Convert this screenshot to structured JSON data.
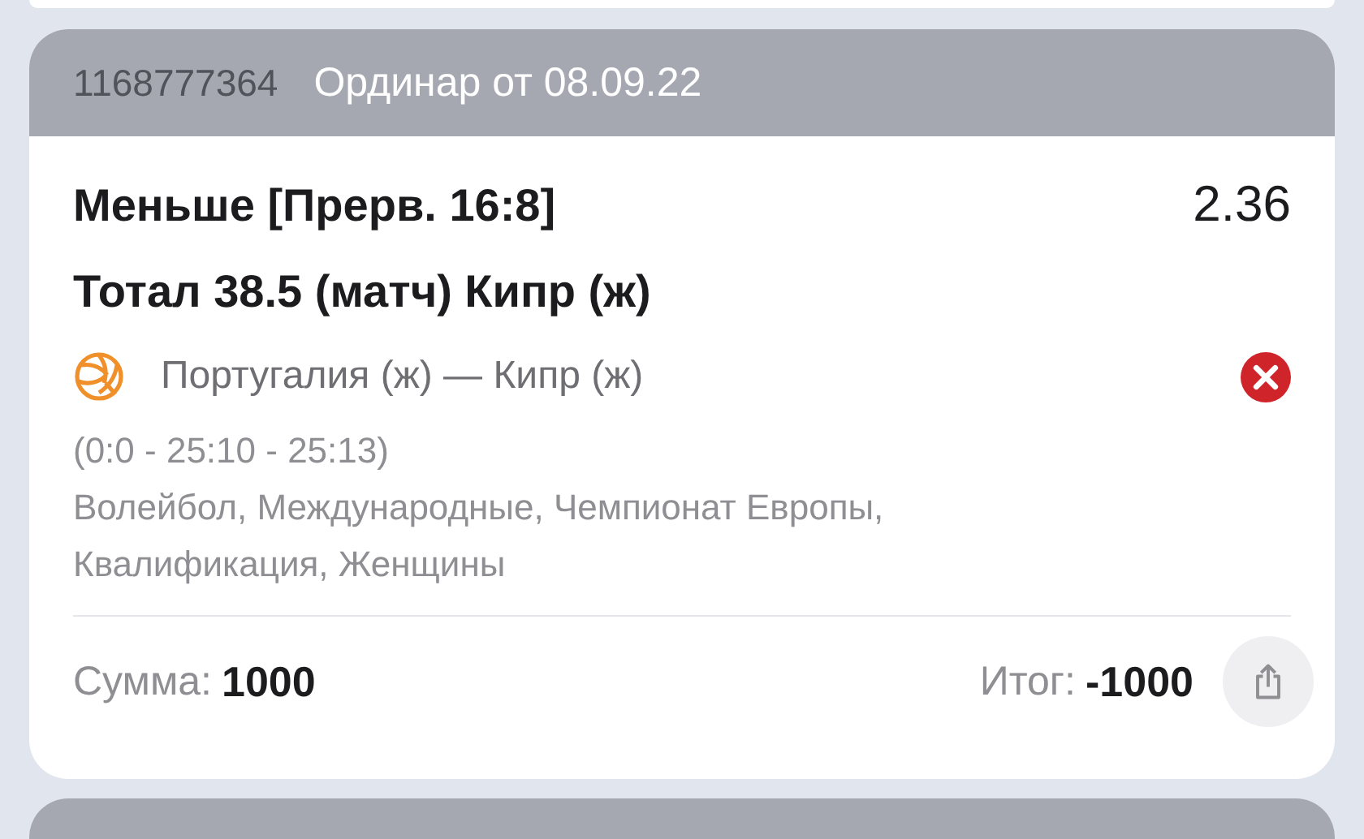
{
  "bet": {
    "id": "1168777364",
    "header": "Ординар от 08.09.22",
    "market": "Меньше [Прерв. 16:8]",
    "odds": "2.36",
    "selection": "Тотал 38.5 (матч) Кипр (ж)",
    "event": "Португалия (ж) — Кипр (ж)",
    "lost": true,
    "score": "(0:0 - 25:10 - 25:13)",
    "tournament": "Волейбол, Международные, Чемпионат Европы, Квалификация, Женщины",
    "stake_label": "Сумма:",
    "stake": "1000",
    "result_label": "Итог:",
    "result": "-1000"
  }
}
